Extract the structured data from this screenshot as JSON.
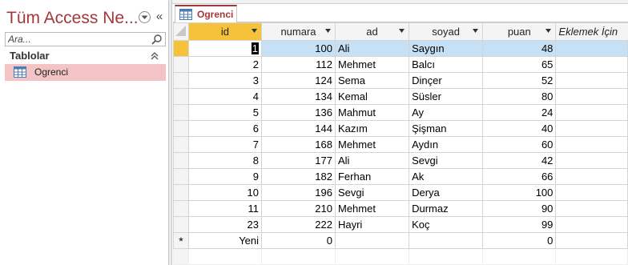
{
  "nav": {
    "title": "Tüm Access Ne...",
    "search_placeholder": "Ara...",
    "section_label": "Tablolar",
    "items": [
      {
        "label": "Ogrenci",
        "icon": "table-icon",
        "selected": true
      }
    ]
  },
  "tab": {
    "label": "Ogrenci",
    "icon": "table-icon"
  },
  "colors": {
    "accent": "#a4373a",
    "selected_nav_item": "#f3c3c6",
    "active_row": "#c6e0f5",
    "active_column_header": "#f7c23b"
  },
  "grid": {
    "columns": [
      "id",
      "numara",
      "ad",
      "soyad",
      "puan",
      "Eklemek İçin"
    ],
    "rows": [
      {
        "id": "1",
        "numara": "100",
        "ad": "Ali",
        "soyad": "Saygın",
        "puan": "48"
      },
      {
        "id": "2",
        "numara": "112",
        "ad": "Mehmet",
        "soyad": "Balcı",
        "puan": "65"
      },
      {
        "id": "3",
        "numara": "124",
        "ad": "Sema",
        "soyad": "Dinçer",
        "puan": "52"
      },
      {
        "id": "4",
        "numara": "134",
        "ad": "Kemal",
        "soyad": "Süsler",
        "puan": "80"
      },
      {
        "id": "5",
        "numara": "136",
        "ad": "Mahmut",
        "soyad": "Ay",
        "puan": "24"
      },
      {
        "id": "6",
        "numara": "144",
        "ad": "Kazım",
        "soyad": "Şişman",
        "puan": "40"
      },
      {
        "id": "7",
        "numara": "168",
        "ad": "Mehmet",
        "soyad": "Aydın",
        "puan": "60"
      },
      {
        "id": "8",
        "numara": "177",
        "ad": "Ali",
        "soyad": "Sevgi",
        "puan": "42"
      },
      {
        "id": "9",
        "numara": "182",
        "ad": "Ferhan",
        "soyad": "Ak",
        "puan": "66"
      },
      {
        "id": "10",
        "numara": "196",
        "ad": "Sevgi",
        "soyad": "Derya",
        "puan": "100"
      },
      {
        "id": "11",
        "numara": "210",
        "ad": "Mehmet",
        "soyad": "Durmaz",
        "puan": "90"
      },
      {
        "id": "23",
        "numara": "222",
        "ad": "Hayri",
        "soyad": "Koç",
        "puan": "99"
      }
    ],
    "new_row": {
      "marker": "*",
      "id": "Yeni",
      "numara": "0",
      "ad": "",
      "soyad": "",
      "puan": "0"
    }
  }
}
